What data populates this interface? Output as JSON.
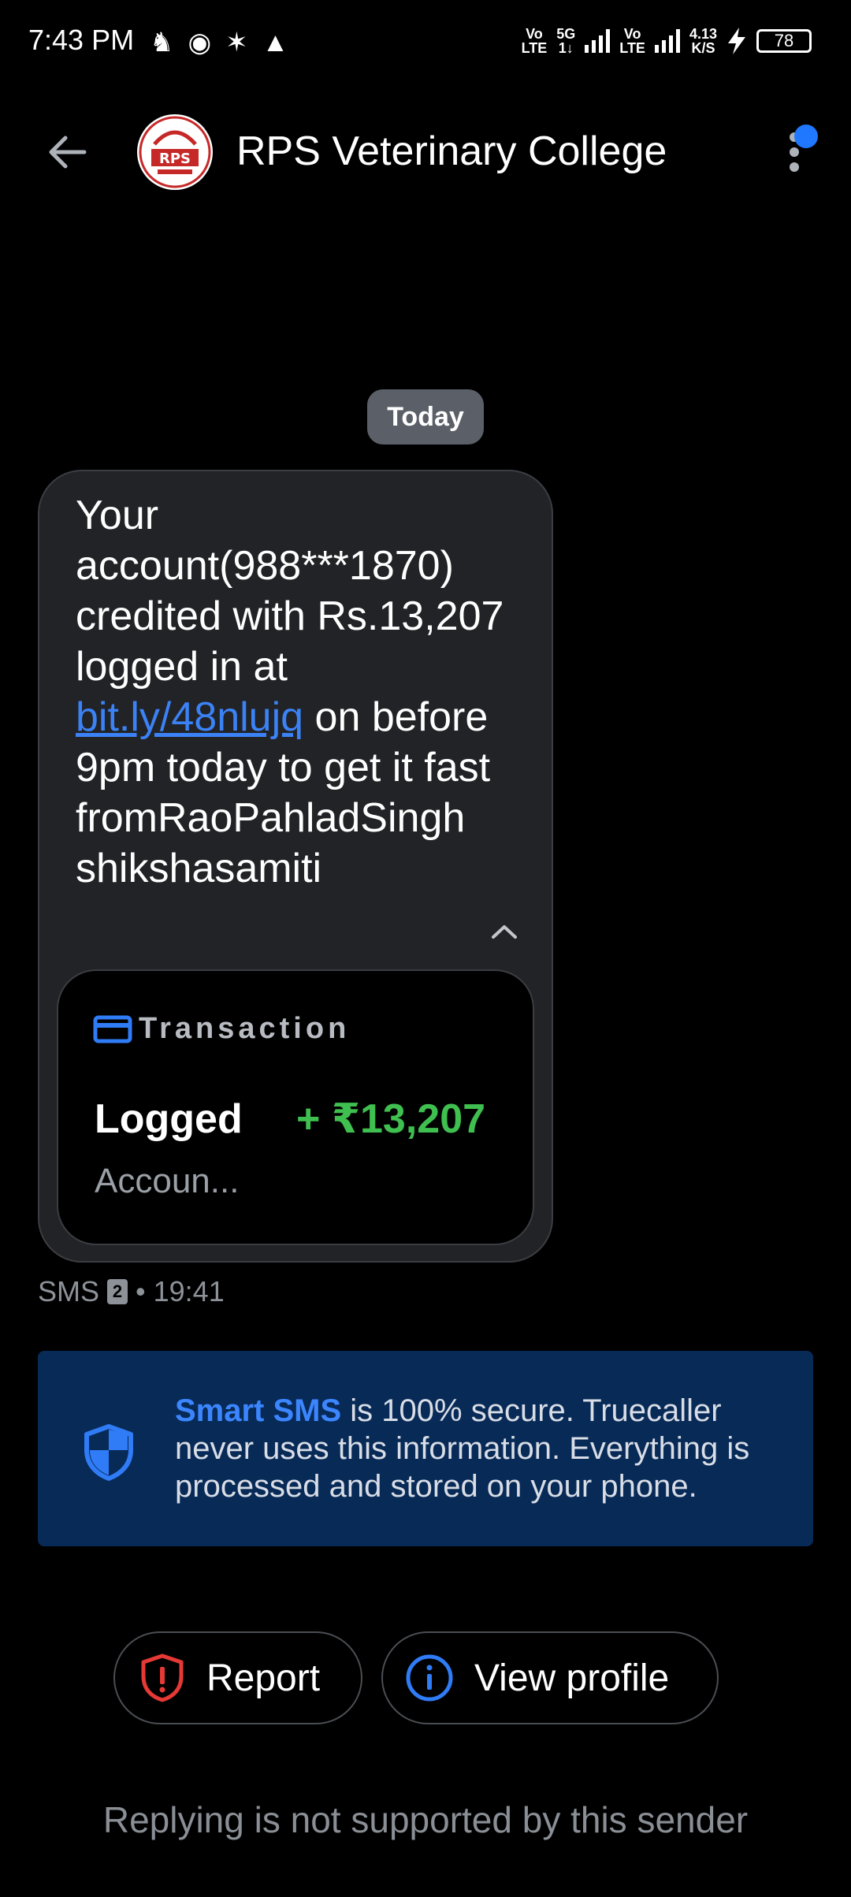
{
  "status_bar": {
    "time": "7:43 PM",
    "network_1_line1": "Vo",
    "network_1_line2": "LTE",
    "network_5g_line1": "5G",
    "network_5g_line2": "1↓",
    "network_2_line1": "Vo",
    "network_2_line2": "LTE",
    "speed_line1": "4.13",
    "speed_line2": "K/S",
    "battery": "78"
  },
  "header": {
    "title": "RPS Veterinary College",
    "avatar_text": "RPS"
  },
  "conversation": {
    "date_chip": "Today",
    "message": {
      "text_before_link": "Your account(988***1870) credited with Rs.13,207 logged in at ",
      "link": "bit.ly/48nlujq",
      "text_after_link": " on before 9pm today to get it fast fromRaoPahladSingh shikshasamiti"
    },
    "transaction_card": {
      "heading": "Transaction",
      "type": "Logged",
      "amount": "+ ₹13,207",
      "subtitle": "Accoun..."
    },
    "meta": {
      "channel": "SMS",
      "sim": "2",
      "time": "• 19:41"
    }
  },
  "smart_sms_banner": {
    "highlight": "Smart SMS",
    "text": " is 100% secure. Truecaller never uses this information. Everything is processed and stored on your phone."
  },
  "actions": {
    "report_label": "Report",
    "view_profile_label": "View profile"
  },
  "footer_note": "Replying is not supported by this sender",
  "colors": {
    "background": "#000000",
    "bubble": "#212326",
    "banner": "#082a57",
    "accent_blue": "#3b86ff",
    "amount_green": "#3fbf4f",
    "report_red": "#e53935"
  }
}
